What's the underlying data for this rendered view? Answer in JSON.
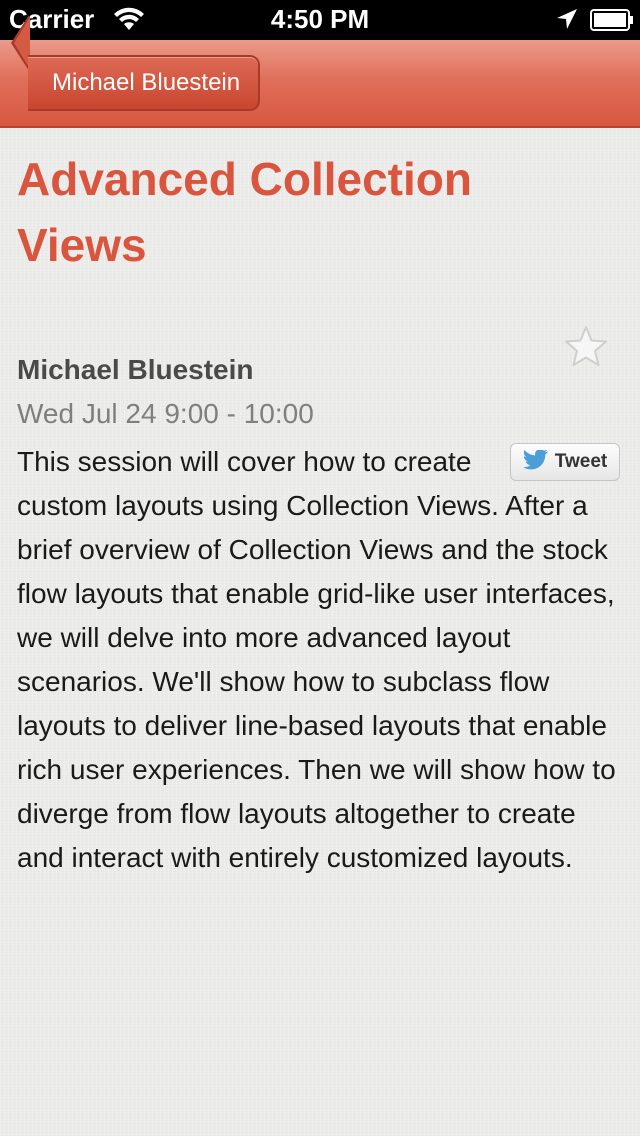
{
  "status_bar": {
    "carrier": "Carrier",
    "time": "4:50 PM",
    "icons": [
      "wifi-icon",
      "location-arrow-icon",
      "battery-icon"
    ]
  },
  "nav_bar": {
    "back_label": "Michael Bluestein",
    "color": "#d9573f"
  },
  "session": {
    "title": "Advanced Collection Views",
    "speaker": "Michael Bluestein",
    "time": "Wed Jul 24 9:00 - 10:00",
    "description": "This session will cover how to create custom layouts using Collection Views. After a brief overview of Collection Views and the stock flow layouts that enable grid-like user interfaces, we will delve into more advanced layout scenarios. We'll show how to subclass flow layouts to deliver line-based layouts that enable rich user experiences. Then we will show how to diverge from flow layouts altogether to create and interact with entirely customized layouts.",
    "favorite_icon": "star-outline-icon",
    "tweet_label": "Tweet",
    "tweet_icon": "twitter-bird-icon"
  },
  "colors": {
    "accent": "#d9553e",
    "speaker": "#4a4a4a",
    "time": "#7f7f7f",
    "body_text": "#1a1a1a"
  }
}
